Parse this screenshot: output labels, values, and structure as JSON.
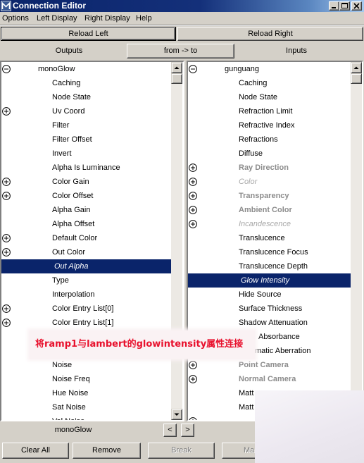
{
  "window": {
    "title": "Connection Editor",
    "app_icon": "maya-icon",
    "controls": [
      "minimize-icon",
      "maximize-icon",
      "close-icon"
    ]
  },
  "menu": [
    "Options",
    "Left Display",
    "Right Display",
    "Help"
  ],
  "reload": {
    "left": "Reload Left",
    "right": "Reload Right"
  },
  "direction": {
    "outputs": "Outputs",
    "button": "from -> to",
    "inputs": "Inputs"
  },
  "left_list": {
    "items": [
      {
        "label": "monoGlow",
        "expander": "minus",
        "node": true
      },
      {
        "label": "Caching"
      },
      {
        "label": "Node State"
      },
      {
        "label": "Uv Coord",
        "expander": "plus"
      },
      {
        "label": "Filter"
      },
      {
        "label": "Filter Offset"
      },
      {
        "label": "Invert"
      },
      {
        "label": "Alpha Is Luminance"
      },
      {
        "label": "Color Gain",
        "expander": "plus"
      },
      {
        "label": "Color Offset",
        "expander": "plus"
      },
      {
        "label": "Alpha Gain"
      },
      {
        "label": "Alpha Offset"
      },
      {
        "label": "Default Color",
        "expander": "plus"
      },
      {
        "label": "Out Color",
        "expander": "plus"
      },
      {
        "label": "Out Alpha",
        "selected": true
      },
      {
        "label": "Type"
      },
      {
        "label": "Interpolation"
      },
      {
        "label": "Color Entry List[0]",
        "expander": "plus"
      },
      {
        "label": "Color Entry List[1]",
        "expander": "plus"
      },
      {},
      {},
      {
        "label": "Noise"
      },
      {
        "label": "Noise Freq"
      },
      {
        "label": "Hue Noise"
      },
      {
        "label": "Sat Noise"
      },
      {
        "label": "Val Noise"
      }
    ]
  },
  "right_list": {
    "items": [
      {
        "label": "gunguang",
        "expander": "minus",
        "node": true
      },
      {
        "label": "Caching"
      },
      {
        "label": "Node State"
      },
      {
        "label": "Refraction Limit"
      },
      {
        "label": "Refractive Index"
      },
      {
        "label": "Refractions"
      },
      {
        "label": "Diffuse"
      },
      {
        "label": "Ray Direction",
        "expander": "plus",
        "look": "bold-gray"
      },
      {
        "label": "Color",
        "expander": "plus",
        "look": "italic-gray"
      },
      {
        "label": "Transparency",
        "expander": "plus",
        "look": "bold-gray"
      },
      {
        "label": "Ambient Color",
        "expander": "plus",
        "look": "bold-gray"
      },
      {
        "label": "Incandescence",
        "expander": "plus",
        "look": "italic-gray"
      },
      {
        "label": "Translucence"
      },
      {
        "label": "Translucence Focus"
      },
      {
        "label": "Translucence Depth"
      },
      {
        "label": "Glow Intensity",
        "selected": true
      },
      {
        "label": "Hide Source"
      },
      {
        "label": "Surface Thickness"
      },
      {
        "label": "Shadow Attenuation"
      },
      {
        "label": "Absorbance"
      },
      {
        "label": "matic Aberration"
      },
      {
        "label": "Point Camera",
        "expander": "plus",
        "look": "bold-gray"
      },
      {
        "label": "Normal Camera",
        "expander": "plus",
        "look": "bold-gray"
      },
      {
        "label": "Matt"
      },
      {
        "label": "Matt"
      },
      {
        "expander": "plus"
      }
    ]
  },
  "annotation": {
    "text": "将ramp1与lambert的glowintensity属性连接"
  },
  "footer": {
    "node_label": "monoGlow",
    "prev_label": "<",
    "next_label": ">"
  },
  "buttons": {
    "clear_all": "Clear All",
    "remove": "Remove",
    "break": "Break",
    "make": "Ma"
  },
  "colors": {
    "selection": "#0a246a",
    "dim_text": "#8c8c8c",
    "annotation_text": "#e8112d",
    "window_bg": "#d4d0c8"
  }
}
